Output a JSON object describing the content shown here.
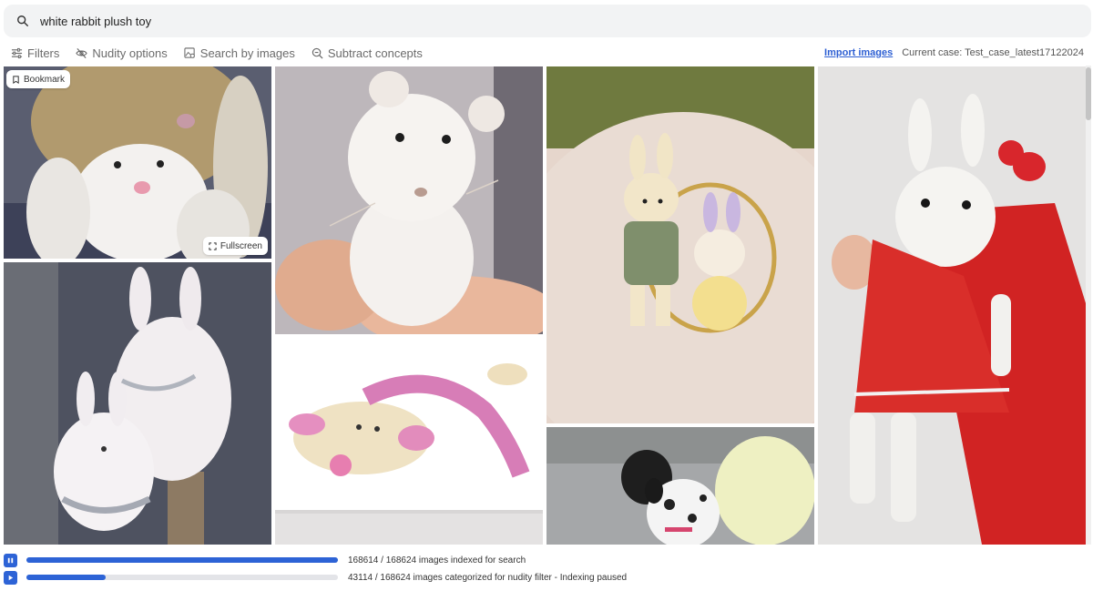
{
  "search": {
    "query": "white rabbit plush toy"
  },
  "toolbar": {
    "filters_label": "Filters",
    "nudity_label": "Nudity options",
    "search_images_label": "Search by images",
    "subtract_label": "Subtract concepts",
    "import_label": "Import images",
    "current_case_label": "Current case: Test_case_latest17122024"
  },
  "overlay": {
    "bookmark_label": "Bookmark",
    "fullscreen_label": "Fullscreen"
  },
  "status": {
    "search_index": {
      "text": "168614 / 168624 images indexed for search",
      "done": 168614,
      "total": 168624,
      "button_icon": "pause-icon"
    },
    "nudity_index": {
      "text": "43114 / 168624 images categorized for nudity filter - Indexing paused",
      "done": 43114,
      "total": 168624,
      "button_icon": "play-icon"
    }
  },
  "colors": {
    "accent": "#2d63d6",
    "link": "#2d5fd3"
  }
}
